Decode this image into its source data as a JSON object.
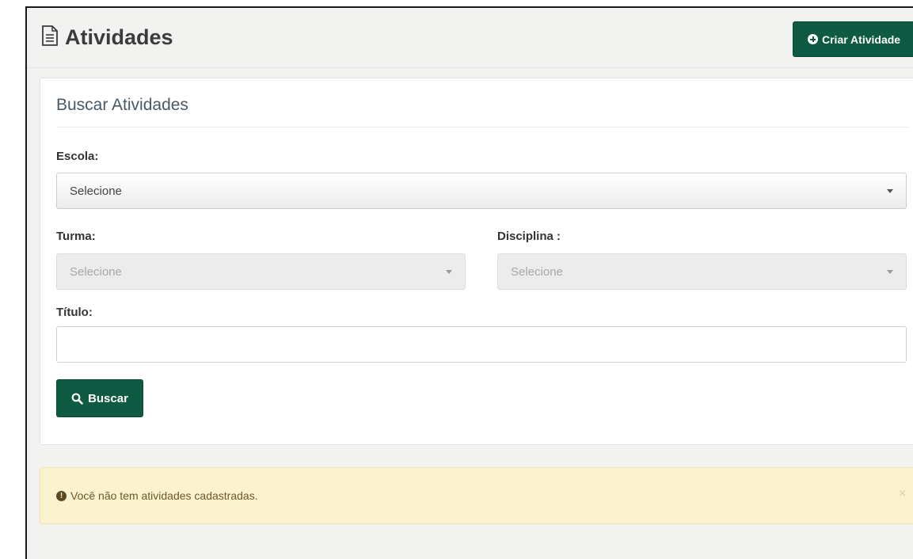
{
  "header": {
    "title": "Atividades",
    "create_button_label": "Criar Atividade"
  },
  "search_panel": {
    "title": "Buscar Atividades",
    "escola": {
      "label": "Escola:",
      "selected": "Selecione"
    },
    "turma": {
      "label": "Turma:",
      "selected": "Selecione"
    },
    "disciplina": {
      "label": "Disciplina :",
      "selected": "Selecione"
    },
    "titulo": {
      "label": "Título:",
      "value": "",
      "placeholder": ""
    },
    "search_button_label": "Buscar"
  },
  "alert": {
    "message": "Você não tem atividades cadastradas.",
    "close_glyph": "×"
  },
  "colors": {
    "primary": "#0e5a43",
    "alert_bg": "#fbf2cf"
  }
}
